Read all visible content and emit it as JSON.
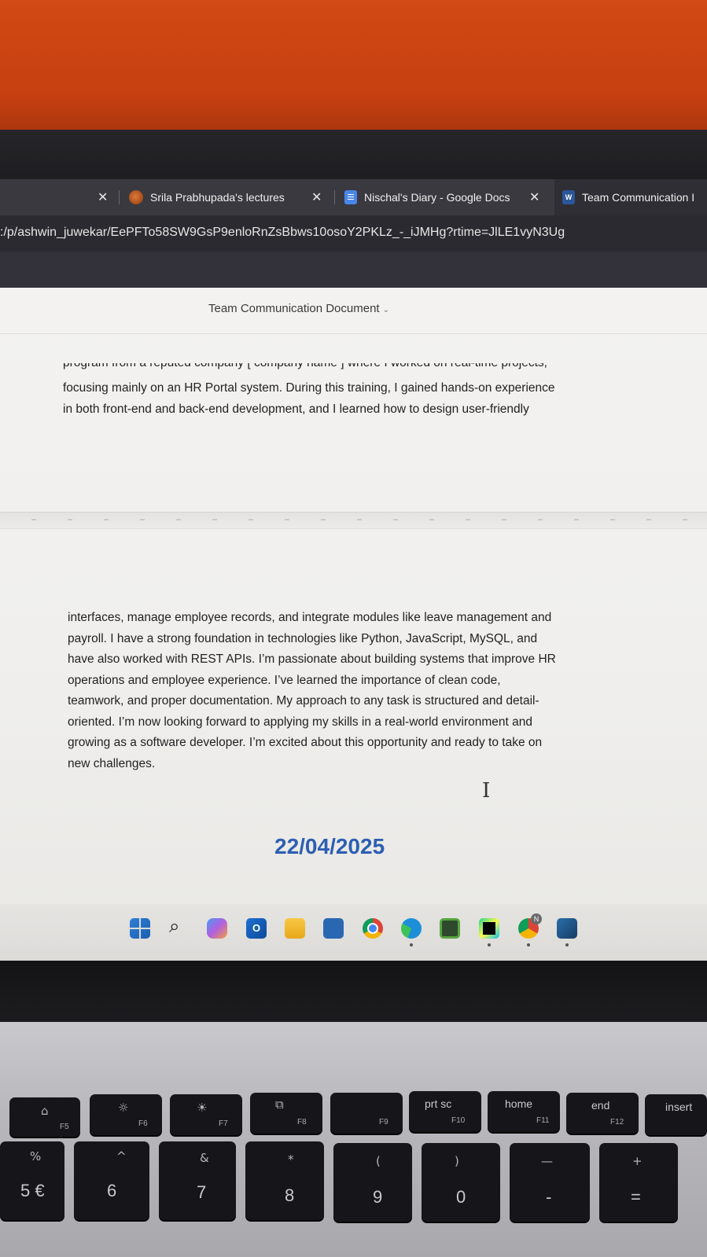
{
  "browser": {
    "tabs": [
      {
        "label": "Srila Prabhupada's lectures"
      },
      {
        "label": "Nischal's Diary - Google Docs"
      },
      {
        "label": "Team Communication I"
      }
    ],
    "close_glyph": "✕",
    "url": ":/p/ashwin_juwekar/EePFTo58SW9GsP9enloRnZsBbws10osoY2PKLz_-_iJMHg?rtime=JlLE1vyN3Ug"
  },
  "document": {
    "title": "Team Communication Document",
    "title_chevron": "⌄",
    "page1_cut_line": "program from a reputed company [ company name ] where I worked on real-time projects,",
    "page1_lines": [
      "focusing mainly on an HR Portal system. During this training, I gained hands-on experience",
      "in both front-end and back-end development, and I learned how to design user-friendly"
    ],
    "page2_lines": [
      "interfaces, manage employee records, and integrate modules like leave management and",
      "payroll. I have a strong foundation in technologies like Python, JavaScript, MySQL, and",
      "have also worked with REST APIs. I’m passionate about building systems that improve HR",
      "operations and employee experience. I’ve learned the importance of clean code,",
      "teamwork, and proper documentation. My approach to any task is structured and detail-",
      "oriented. I’m now looking forward to applying my skills in a real-world environment and",
      "growing as a software developer. I’m excited about this opportunity and ready to take on",
      "new challenges."
    ],
    "date": "22/04/2025",
    "cursor_glyph": "I"
  },
  "taskbar": {
    "icons": [
      "windows-start-icon",
      "search-icon",
      "copilot-icon",
      "outlook-icon",
      "file-explorer-icon",
      "store-icon",
      "chrome-icon",
      "edge-icon",
      "chip-app-icon",
      "pycharm-icon",
      "chrome-profile-icon",
      "tool-app-icon"
    ],
    "search_glyph": "⌕",
    "outlook_letter": "O",
    "pycharm_label": "PC",
    "profile_badge": "N"
  },
  "keyboard": {
    "function_row": [
      {
        "icon": "⌂",
        "fn": "F5"
      },
      {
        "icon": "☼",
        "fn": "F6"
      },
      {
        "icon": "☀",
        "fn": "F7"
      },
      {
        "icon": "⧉",
        "fn": "F8"
      },
      {
        "icon": "",
        "fn": "F9"
      },
      {
        "label": "prt sc",
        "fn": "F10"
      },
      {
        "label": "home",
        "fn": "F11"
      },
      {
        "label": "end",
        "fn": "F12"
      },
      {
        "label": "insert",
        "fn": ""
      }
    ],
    "number_row": [
      {
        "top": "%",
        "main": "5 €"
      },
      {
        "top": "^",
        "main": "6"
      },
      {
        "top": "&",
        "main": "7"
      },
      {
        "top": "*",
        "main": "8"
      },
      {
        "top": "(",
        "main": "9"
      },
      {
        "top": ")",
        "main": "0"
      },
      {
        "top": "—",
        "main": "-"
      },
      {
        "top": "+",
        "main": "="
      }
    ]
  }
}
